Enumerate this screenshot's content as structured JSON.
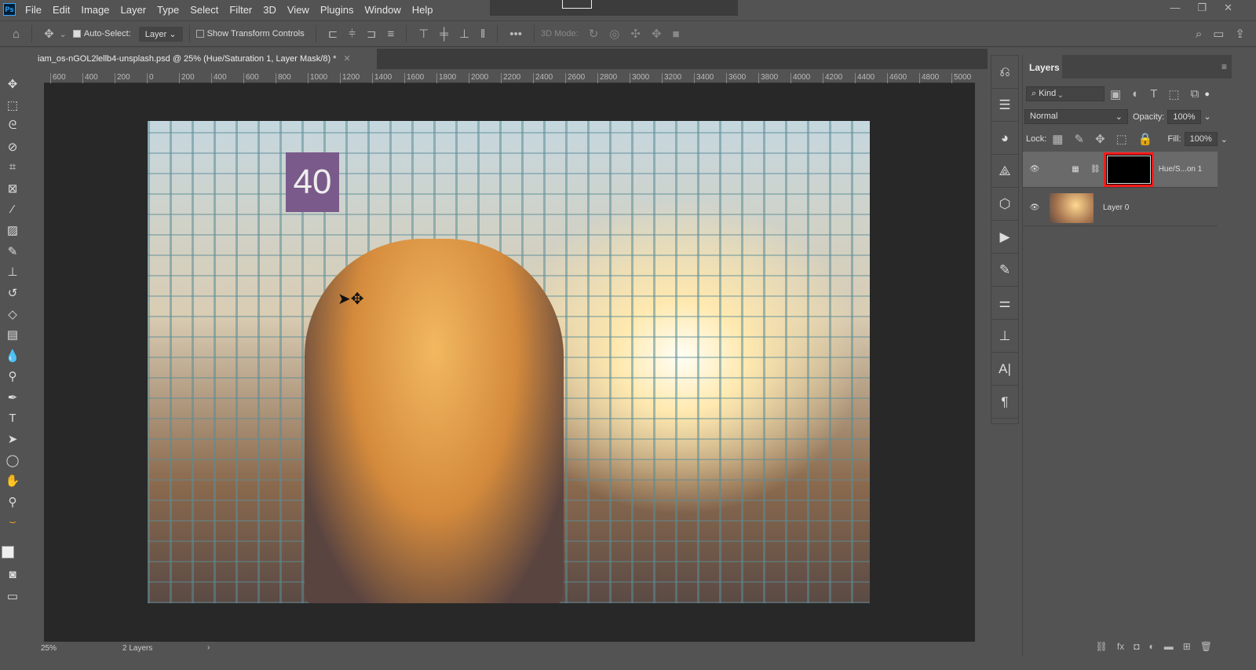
{
  "menu": [
    "File",
    "Edit",
    "Image",
    "Layer",
    "Type",
    "Select",
    "Filter",
    "3D",
    "View",
    "Plugins",
    "Window",
    "Help"
  ],
  "options": {
    "auto_select_label": "Auto-Select:",
    "auto_select_checked": true,
    "target": "Layer",
    "show_transform_label": "Show Transform Controls",
    "show_transform_checked": false,
    "mode_3d_label": "3D Mode:"
  },
  "document_tab": "iam_os-nGOL2lellb4-unsplash.psd @ 25% (Hue/Saturation 1, Layer Mask/8) *",
  "ruler_labels": [
    "600",
    "400",
    "200",
    "0",
    "200",
    "400",
    "600",
    "800",
    "1000",
    "1200",
    "1400",
    "1600",
    "1800",
    "2000",
    "2200",
    "2400",
    "2600",
    "2800",
    "3000",
    "3200",
    "3400",
    "3600",
    "3800",
    "4000",
    "4200",
    "4400",
    "4600",
    "4800",
    "5000"
  ],
  "canvas": {
    "sign_text": "40"
  },
  "status": {
    "zoom": "25%",
    "info": "2 Layers"
  },
  "layers_panel": {
    "title": "Layers",
    "filter": "Kind",
    "blend_mode": "Normal",
    "opacity_label": "Opacity:",
    "opacity": "100%",
    "lock_label": "Lock:",
    "fill_label": "Fill:",
    "fill": "100%",
    "layers": [
      {
        "name": "Hue/S...on 1",
        "selected": true,
        "visible": true
      },
      {
        "name": "Layer 0",
        "selected": false,
        "visible": true
      }
    ],
    "highlight_color": "#ff1a1a"
  }
}
